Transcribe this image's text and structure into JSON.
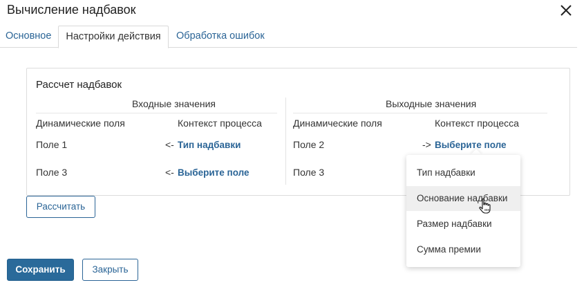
{
  "dialog": {
    "title": "Вычисление надбавок",
    "close_icon": "close-icon"
  },
  "tabs": [
    {
      "label": "Основное",
      "active": false
    },
    {
      "label": "Настройки действия",
      "active": true
    },
    {
      "label": "Обработка ошибок",
      "active": false
    }
  ],
  "panel": {
    "title": "Рассчет надбавок",
    "input": {
      "heading": "Входные значения",
      "col_fields": "Динамические поля",
      "col_context": "Контекст процесса",
      "rows": [
        {
          "field": "Поле 1",
          "arrow": "<-",
          "value": "Тип надбавки"
        },
        {
          "field": "Поле 3",
          "arrow": "<-",
          "value": "Выберите поле"
        }
      ]
    },
    "output": {
      "heading": "Выходные значения",
      "col_fields": "Динамические поля",
      "col_context": "Контекст процесса",
      "rows": [
        {
          "field": "Поле 2",
          "arrow": "->",
          "value": "Выберите поле"
        },
        {
          "field": "Поле 3"
        }
      ]
    }
  },
  "buttons": {
    "calculate": "Рассчитать",
    "save": "Сохранить",
    "close": "Закрыть"
  },
  "dropdown": {
    "items": [
      "Тип надбавки",
      "Основание надбавки",
      "Размер надбавки",
      "Сумма премии"
    ],
    "hovered_index": 1
  },
  "colors": {
    "link": "#2a6496",
    "primary": "#2a6a9a",
    "border": "#dcdcdc"
  }
}
